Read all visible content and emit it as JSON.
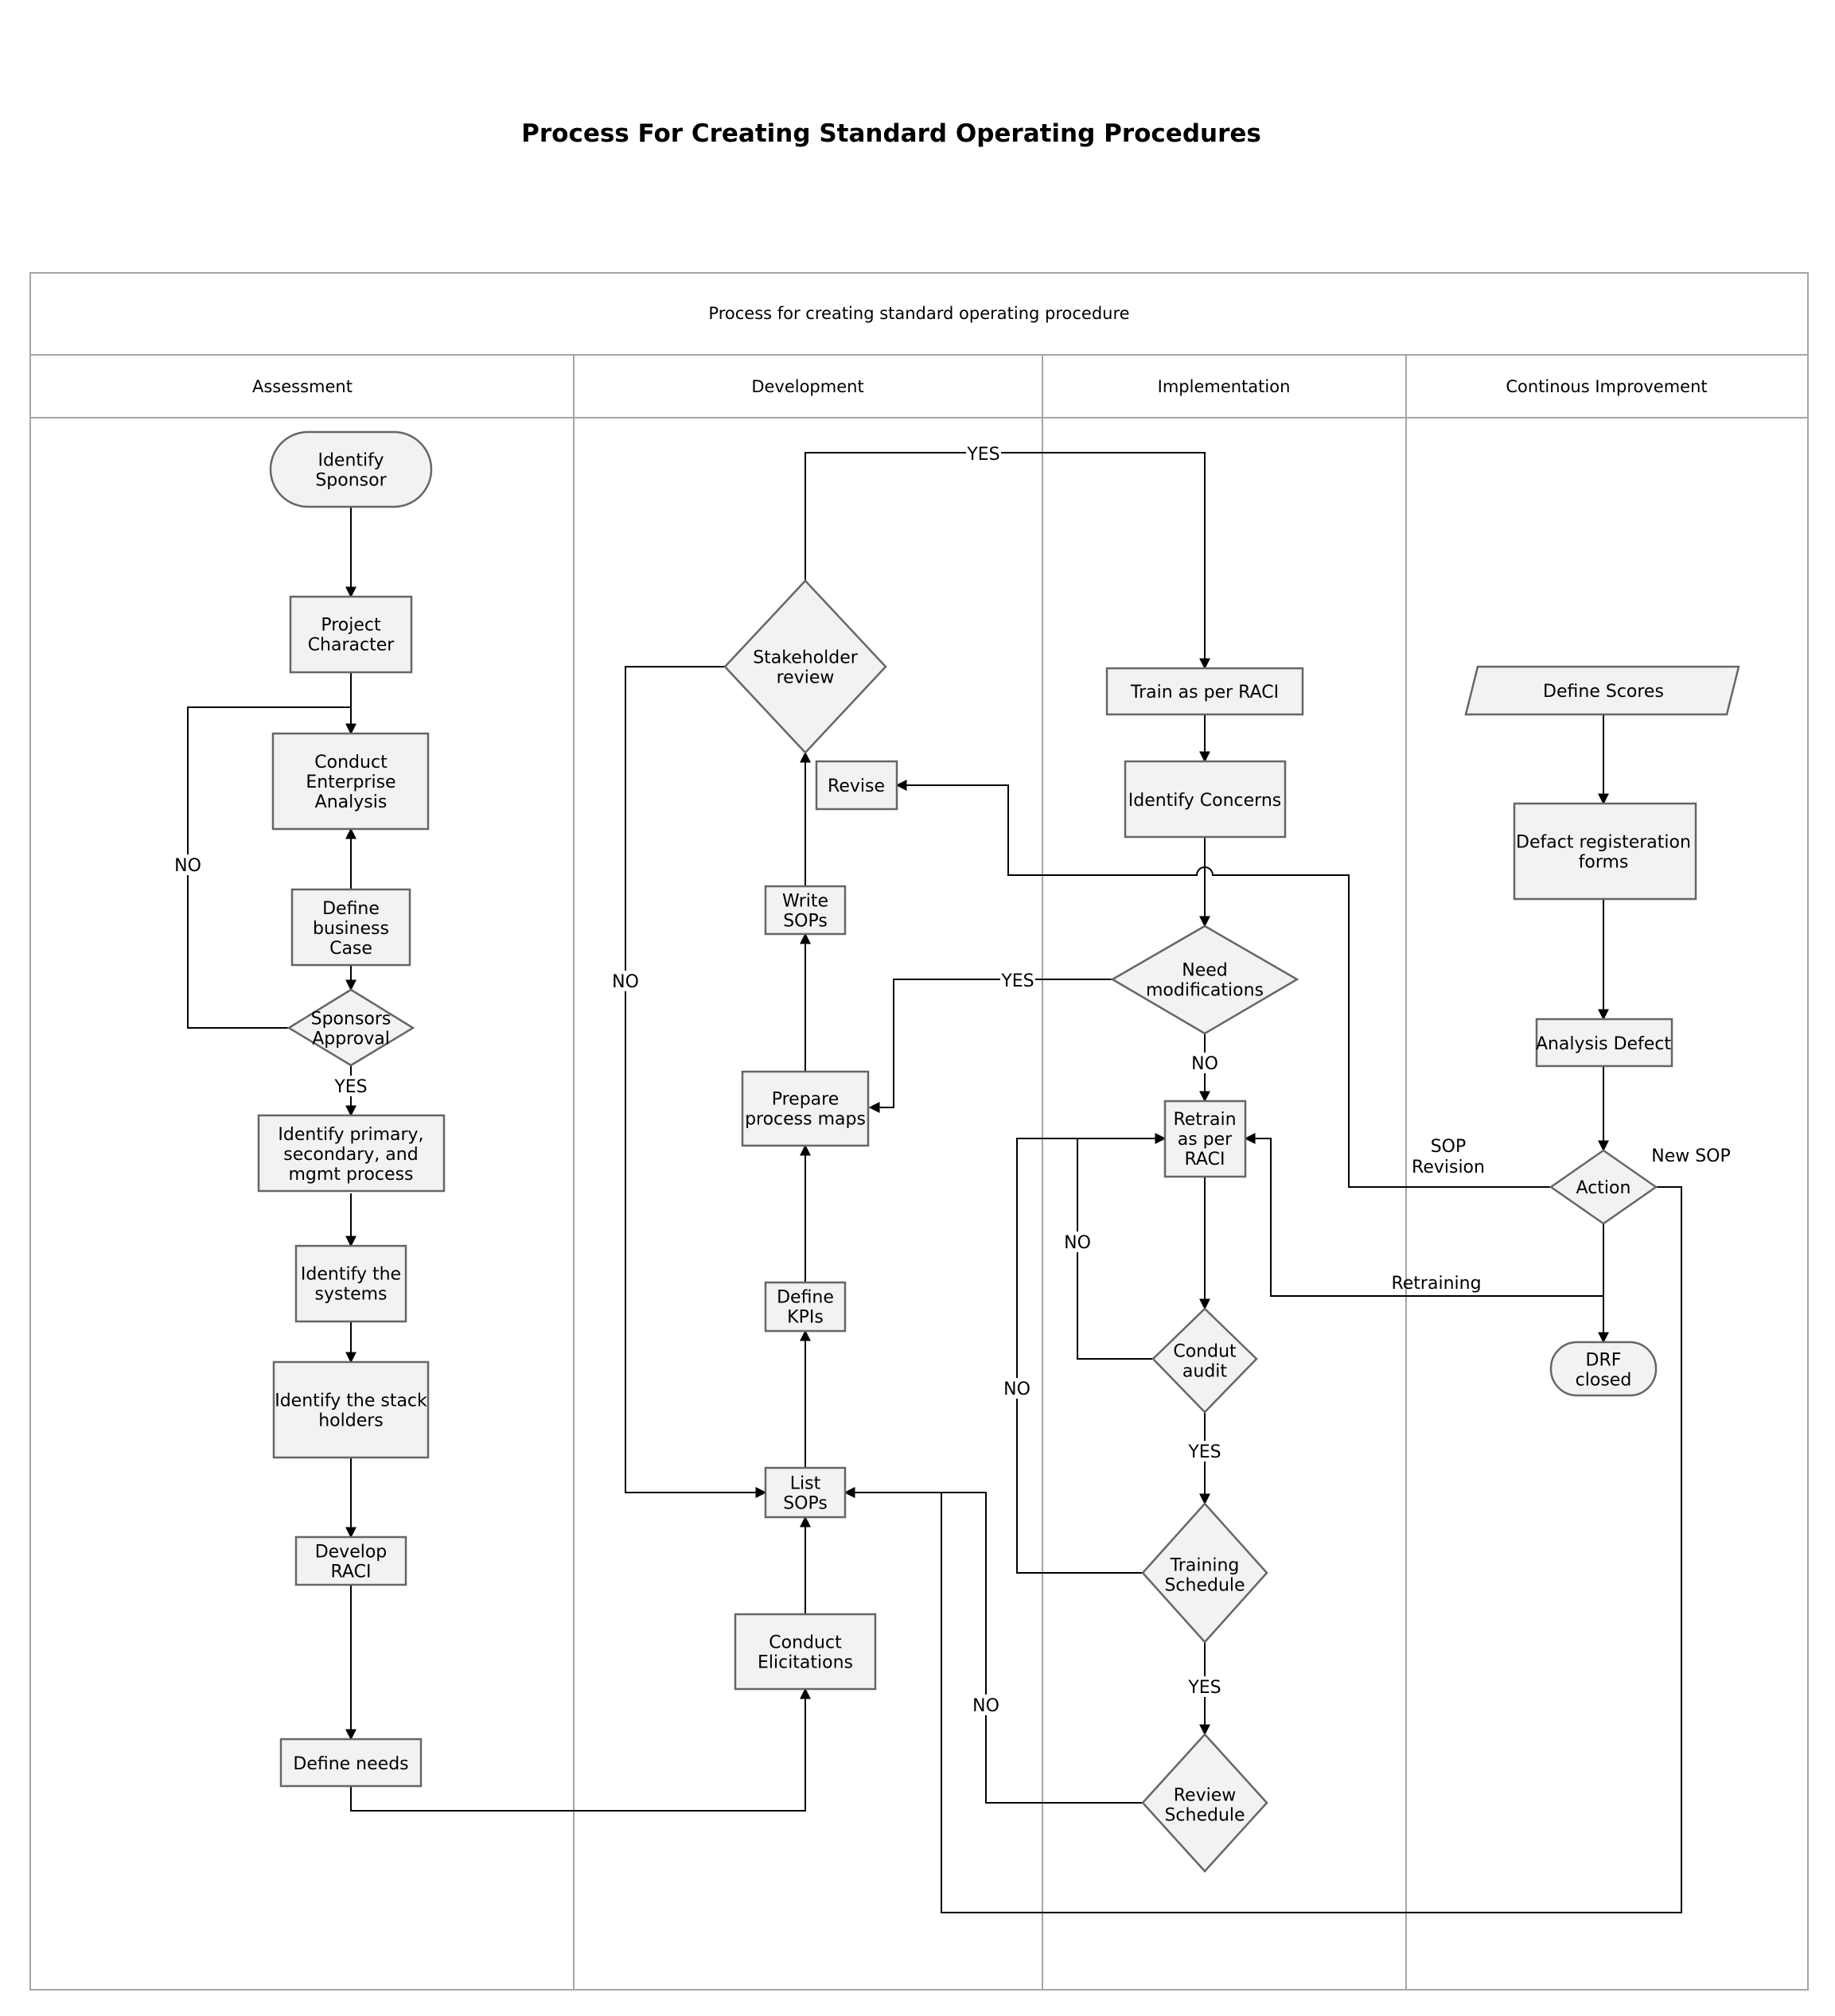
{
  "title": "Process For Creating Standard Operating Procedures",
  "pool": {
    "title": "Process for creating standard operating procedure",
    "lanes": [
      "Assessment",
      "Development",
      "Implementation",
      "Continous Improvement"
    ]
  },
  "nodes": {
    "identify_sponsor": [
      "Identify",
      "Sponsor"
    ],
    "project_character": [
      "Project",
      "Character"
    ],
    "conduct_enterprise_analysis": [
      "Conduct",
      "Enterprise",
      "Analysis"
    ],
    "define_business_case": [
      "Define",
      "business",
      "Case"
    ],
    "sponsors_approval": [
      "Sponsors",
      "Approval"
    ],
    "identify_processes": [
      "Identify primary,",
      "secondary, and",
      "mgmt process"
    ],
    "identify_systems": [
      "Identify the",
      "systems"
    ],
    "identify_stakeholders": [
      "Identify the stack",
      "holders"
    ],
    "develop_raci": [
      "Develop",
      "RACI"
    ],
    "define_needs": [
      "Define needs"
    ],
    "stakeholder_review": [
      "Stakeholder",
      "review"
    ],
    "revise": [
      "Revise"
    ],
    "write_sops": [
      "Write",
      "SOPs"
    ],
    "prepare_process_maps": [
      "Prepare",
      "process maps"
    ],
    "define_kpis": [
      "Define",
      "KPIs"
    ],
    "list_sops": [
      "List",
      "SOPs"
    ],
    "conduct_elicitations": [
      "Conduct",
      "Elicitations"
    ],
    "train_as_per_raci": [
      "Train as per RACI"
    ],
    "identify_concerns": [
      "Identify Concerns"
    ],
    "need_modifications": [
      "Need",
      "modifications"
    ],
    "retrain_as_per_raci": [
      "Retrain",
      "as per",
      "RACI"
    ],
    "conduct_audit": [
      "Condut",
      "audit"
    ],
    "training_schedule": [
      "Training",
      "Schedule"
    ],
    "review_schedule": [
      "Review",
      "Schedule"
    ],
    "define_scores": [
      "Define Scores"
    ],
    "defect_registration_forms": [
      "Defact registeration",
      "forms"
    ],
    "analysis_defect": [
      "Analysis Defect"
    ],
    "action": [
      "Action"
    ],
    "drf_closed": [
      "DRF",
      "closed"
    ]
  },
  "edge_labels": {
    "sponsors_no": "NO",
    "sponsors_yes": "YES",
    "stakeholder_yes": "YES",
    "stakeholder_no": "NO",
    "modifications_yes": "YES",
    "modifications_no": "NO",
    "audit_no": "NO",
    "audit_yes": "YES",
    "training_no": "NO",
    "training_yes": "YES",
    "review_no": "NO",
    "sop_revision": [
      "SOP",
      "Revision"
    ],
    "new_sop": "New SOP",
    "retraining": "Retraining"
  },
  "colors": {
    "shape_fill": "#f2f2f2",
    "shape_stroke": "#666666",
    "lane_stroke": "#a6a6a6",
    "edge_stroke": "#000000"
  }
}
